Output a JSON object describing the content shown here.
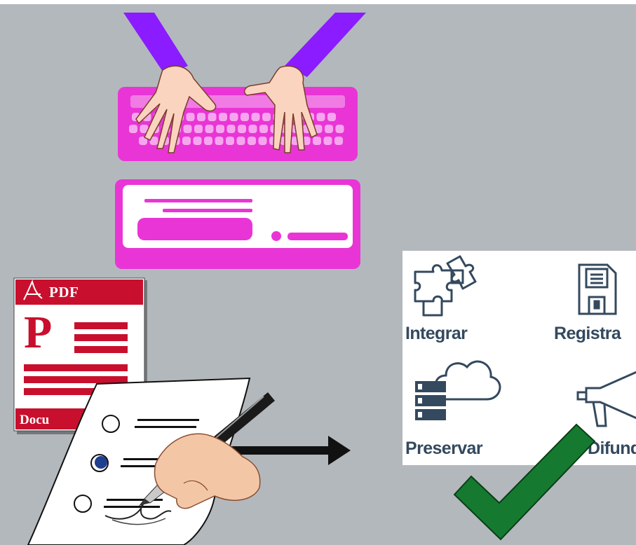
{
  "pdf": {
    "badge_text": "PDF",
    "big_letter": "P",
    "footer_text": "Docu"
  },
  "actions": {
    "integrar": "Integrar",
    "registrar": "Registra",
    "preservar": "Preservar",
    "difundir": "Difund"
  },
  "colors": {
    "background": "#b3b8bd",
    "magenta": "#e935d6",
    "purple": "#8a1cff",
    "pdf_red": "#c8102e",
    "panel_text": "#34495e",
    "check_green": "#157a30"
  },
  "icons": [
    "keyboard-icon",
    "hands-icon",
    "form-screen-icon",
    "pdf-document-icon",
    "signed-form-icon",
    "pen-hand-icon",
    "arrow-right-icon",
    "puzzle-icon",
    "floppy-disk-icon",
    "server-cloud-icon",
    "megaphone-icon",
    "checkmark-icon"
  ]
}
